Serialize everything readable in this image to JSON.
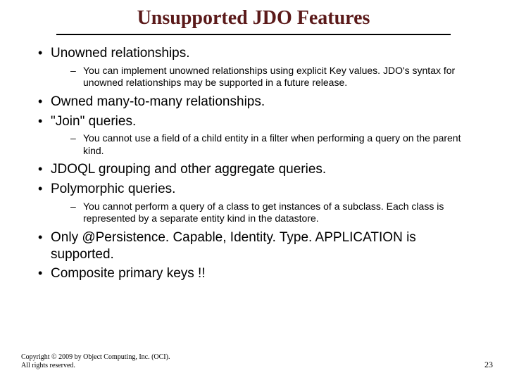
{
  "title": "Unsupported JDO Features",
  "bullets": [
    {
      "text": "Unowned relationships.",
      "sub": [
        "You can implement unowned relationships using explicit Key values. JDO's syntax for unowned relationships may be supported in a future release."
      ]
    },
    {
      "text": "Owned many-to-many relationships."
    },
    {
      "text": "\"Join\" queries.",
      "sub": [
        "You cannot use a field of a child entity in a filter when performing a query on the parent kind."
      ]
    },
    {
      "text": "JDOQL grouping and other aggregate queries."
    },
    {
      "text": "Polymorphic queries.",
      "sub": [
        "You cannot perform a query of a class to get instances of a subclass. Each class is represented by a separate entity kind in the datastore."
      ]
    },
    {
      "text": "Only @Persistence. Capable, Identity. Type. APPLICATION is supported."
    },
    {
      "text": "Composite primary keys !!"
    }
  ],
  "footer": {
    "copyright_line1": "Copyright © 2009 by Object Computing, Inc. (OCI).",
    "copyright_line2": "All rights reserved.",
    "page": "23"
  }
}
